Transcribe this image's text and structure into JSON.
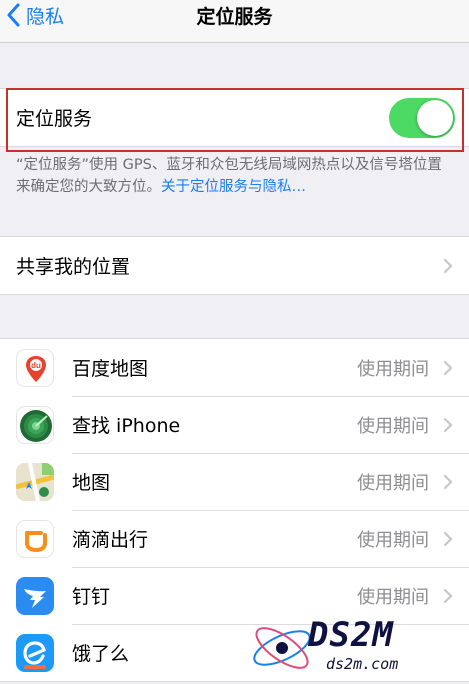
{
  "nav": {
    "back_label": "隐私",
    "title": "定位服务"
  },
  "location_services": {
    "label": "定位服务",
    "enabled": true
  },
  "footnote": {
    "text": "“定位服务”使用 GPS、蓝牙和众包无线局域网热点以及信号塔位置来确定您的大致方位。",
    "link": "关于定位服务与隐私…"
  },
  "share_location": {
    "label": "共享我的位置"
  },
  "apps": [
    {
      "name": "百度地图",
      "value": "使用期间",
      "icon": "baidu-maps-icon"
    },
    {
      "name": "查找 iPhone",
      "value": "使用期间",
      "icon": "find-iphone-icon"
    },
    {
      "name": "地图",
      "value": "使用期间",
      "icon": "maps-icon"
    },
    {
      "name": "滴滴出行",
      "value": "使用期间",
      "icon": "didi-icon"
    },
    {
      "name": "钉钉",
      "value": "使用期间",
      "icon": "dingtalk-icon"
    },
    {
      "name": "饿了么",
      "value": "",
      "icon": "eleme-icon"
    }
  ],
  "watermark": {
    "logo": "DS2M",
    "url": "ds2m.com"
  },
  "colors": {
    "accent": "#1a7ef5",
    "toggle_on": "#4cd964",
    "highlight": "#c9302c"
  }
}
